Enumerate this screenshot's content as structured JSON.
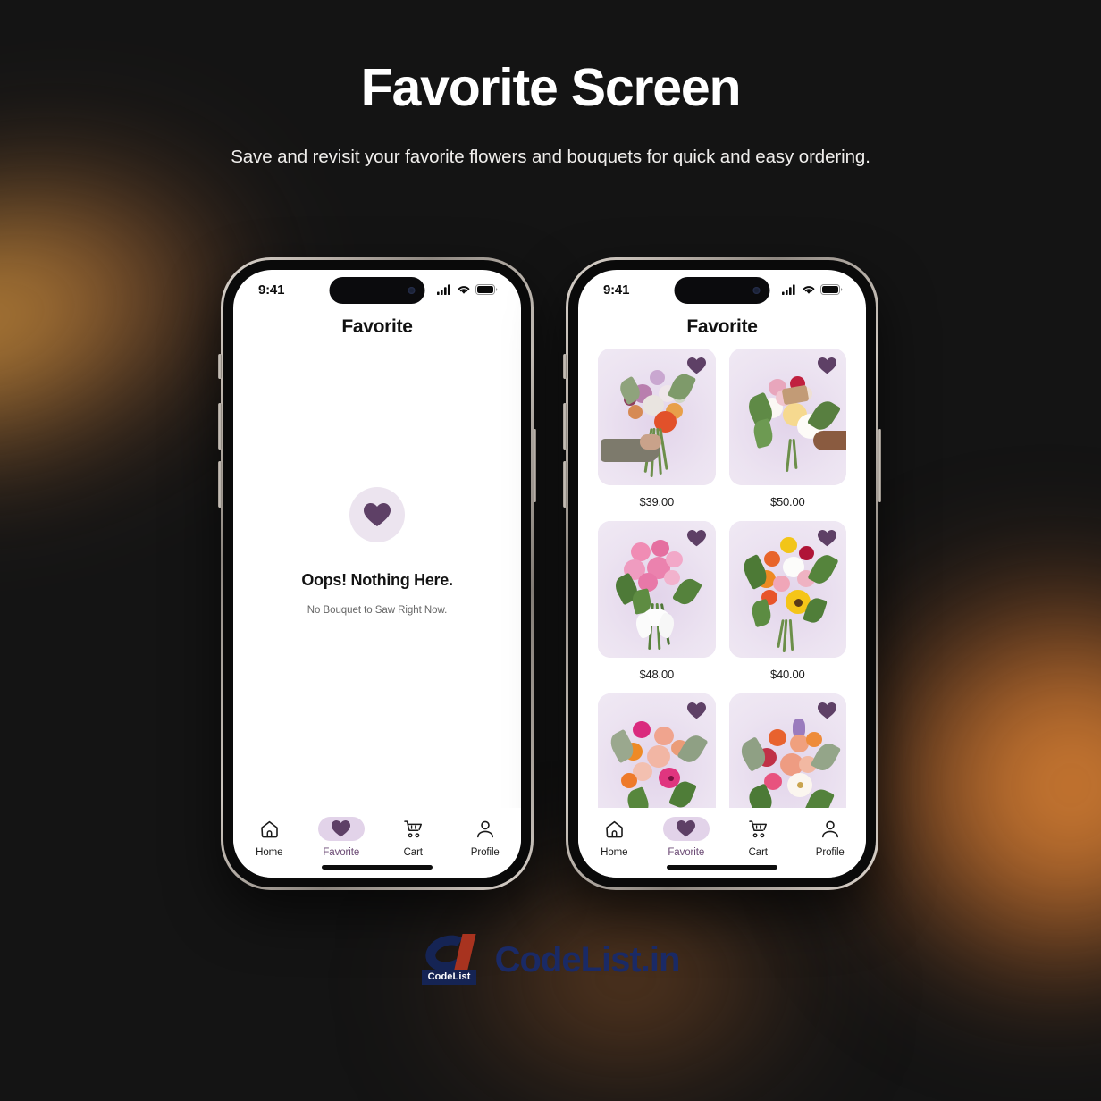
{
  "page": {
    "title": "Favorite Screen",
    "subtitle": "Save and revisit your favorite flowers and bouquets for quick and easy ordering.",
    "background_color": "#141414",
    "accent_color": "#5e4066",
    "accent_soft_color": "#e2d3e9"
  },
  "status_bar": {
    "time": "9:41",
    "icons": [
      "cellular-signal-icon",
      "wifi-icon",
      "battery-icon"
    ]
  },
  "app": {
    "header_title": "Favorite"
  },
  "empty_state": {
    "icon": "heart-icon",
    "title": "Oops! Nothing Here.",
    "subtitle": "No Bouquet to Saw Right Now."
  },
  "favorites": {
    "items": [
      {
        "price": "$39.00",
        "favorited": true,
        "alt": "mixed-pastel-bouquet-held-in-hand"
      },
      {
        "price": "$50.00",
        "favorited": true,
        "alt": "white-and-pink-peony-bouquet"
      },
      {
        "price": "$48.00",
        "favorited": true,
        "alt": "pink-rose-bouquet-with-white-ribbon"
      },
      {
        "price": "$40.00",
        "favorited": true,
        "alt": "bright-mixed-sunflower-bouquet"
      },
      {
        "price": "",
        "favorited": true,
        "alt": "pink-and-orange-gerbera-bouquet"
      },
      {
        "price": "",
        "favorited": true,
        "alt": "coral-gerbera-and-lavender-bouquet"
      }
    ]
  },
  "bottom_nav": {
    "items": [
      {
        "label": "Home",
        "icon": "home-icon",
        "active": false
      },
      {
        "label": "Favorite",
        "icon": "heart-icon",
        "active": true
      },
      {
        "label": "Cart",
        "icon": "cart-icon",
        "active": false
      },
      {
        "label": "Profile",
        "icon": "person-icon",
        "active": false
      }
    ]
  },
  "footer": {
    "logo_tag": "CodeList",
    "logo_word": "CodeList.in"
  }
}
